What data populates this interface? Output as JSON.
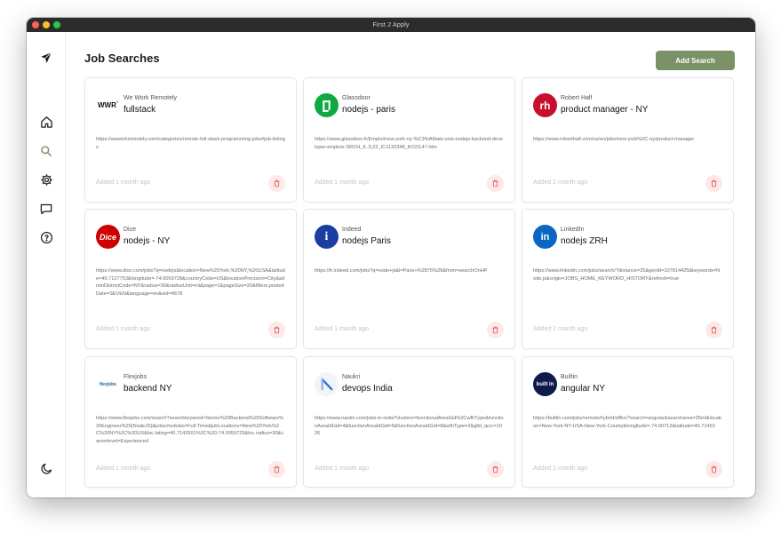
{
  "window": {
    "title": "First 2 Apply"
  },
  "header": {
    "title": "Job Searches",
    "add_button": "Add Search"
  },
  "colors": {
    "accent": "#7a9266",
    "delete_bg": "#fde9e9",
    "delete_icon": "#e05656"
  },
  "cards": [
    {
      "site": "We Work Remotely",
      "title": "fullstack",
      "url": "https://weworkremotely.com/categories/remote-full-stack-programming-jobs#job-listings",
      "added": "Added 1 month ago",
      "logo": "weworkremotely-logo",
      "logo_text": "WWR"
    },
    {
      "site": "Glassdoor",
      "title": "nodejs - paris",
      "url": "https://www.glassdoor.fr/Emploi/new-york-ny-%C3%A9tats-unis-nodejs-backend-developer-emplois-SRCH_IL.0,22_IC1132348_KO23,47.htm",
      "added": "Added 1 month ago",
      "logo": "glassdoor-logo"
    },
    {
      "site": "Robert Half",
      "title": "product manager - NY",
      "url": "https://www.roberthalf.com/us/en/jobs/new-york%2C-ny/product-manager",
      "added": "Added 1 month ago",
      "logo": "roberthalf-logo",
      "logo_text": "rh"
    },
    {
      "site": "Dice",
      "title": "nodejs - NY",
      "url": "https://www.dice.com/jobs?q=nodejs&location=New%20York,%20NY,%20USA&latitude=40.7127753&longitude=-74.0059728&countryCode=US&locationPrecision=City&adminDistrictCode=NY&radius=30&radiusUnit=mi&page=1&pageSize=20&filters.postedDate=SEVEN&language=en&eid=4678",
      "added": "Added 1 month ago",
      "logo": "dice-logo",
      "logo_text": "Dice"
    },
    {
      "site": "Indeed",
      "title": "nodejs Paris",
      "url": "https://fr.indeed.com/jobs?q=node+js&l=Paris+%2875%29&from=searchOnHP",
      "added": "Added 1 month ago",
      "logo": "indeed-logo",
      "logo_text": "i"
    },
    {
      "site": "LinkedIn",
      "title": "nodejs ZRH",
      "url": "https://www.linkedin.com/jobs/search/?distance=25&geoId=107814425&keywords=Node.js&origin=JOBS_HOME_KEYWORD_HISTORY&refresh=true",
      "added": "Added 1 month ago",
      "logo": "linkedin-logo",
      "logo_text": "in"
    },
    {
      "site": "Flexjobs",
      "title": "backend NY",
      "url": "https://www.flexjobs.com/search?searchkeyword=Senior%20Backend%20Software%20Engineer%20(NodeJS)&jobschedules=Full-Time&jobLocations=New%20York%2C%20NY%2C%20US&loc.lating=40.7142691%2C%20-74.0059729&loc.radius=30&careerlevel=Experienced",
      "added": "Added 1 month ago",
      "logo": "flexjobs-logo",
      "logo_text": "flexjobs"
    },
    {
      "site": "Naukri",
      "title": "devops India",
      "url": "https://www.naukri.com/jobs-in-india?clusters=functionalAreaGid%2CwfhType&functionAreaIdGid=4&functionAreaIdGid=5&functionAreaIdGid=8&wfhType=2&glbl_qcrc=1026",
      "added": "Added 1 month ago",
      "logo": "naukri-logo"
    },
    {
      "site": "Builtin",
      "title": "angular NY",
      "url": "https://builtin.com/jobs/remote/hybrid/office?search=angular&searcharea=25mi&location=New-York-NY-USA-New-York-County&longitude=-74.00712&latitude=40.71453",
      "added": "Added 1 month ago",
      "logo": "builtin-logo",
      "logo_text": "built in"
    }
  ]
}
